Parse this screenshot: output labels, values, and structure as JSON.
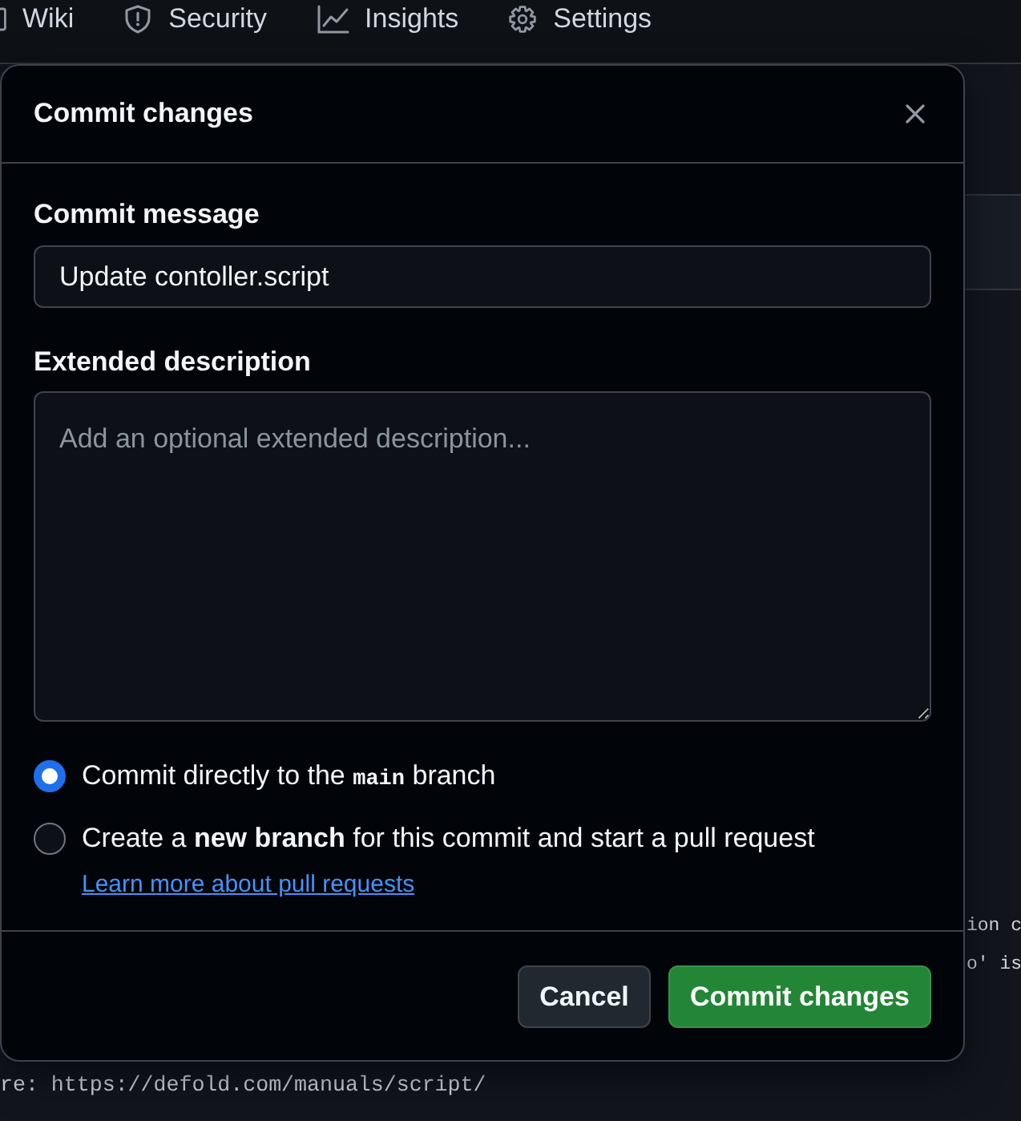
{
  "nav": {
    "tabs": [
      {
        "label": "Wiki",
        "selected": false
      },
      {
        "label": "Security",
        "selected": false
      },
      {
        "label": "Insights",
        "selected": false
      },
      {
        "label": "Settings",
        "selected": false
      }
    ]
  },
  "background": {
    "right_edge_code": [
      "ion c",
      "o' is"
    ],
    "bottom_code": [
      "re: https://defold.com/manuals/script/"
    ]
  },
  "dialog": {
    "title": "Commit changes",
    "commit_message": {
      "label": "Commit message",
      "value": "Update contoller.script"
    },
    "extended_description": {
      "label": "Extended description",
      "placeholder": "Add an optional extended description..."
    },
    "options": [
      {
        "text": "Commit directly to the",
        "code": "main",
        "text_after": "branch",
        "selected": true
      },
      {
        "text": "Create a **new branch** for this commit and start a pull request",
        "link": "Learn more about pull requests",
        "selected": false
      }
    ],
    "buttons": [
      {
        "kind": "secondary",
        "label": "Cancel"
      },
      {
        "kind": "primary",
        "label": "Commit changes"
      }
    ]
  }
}
